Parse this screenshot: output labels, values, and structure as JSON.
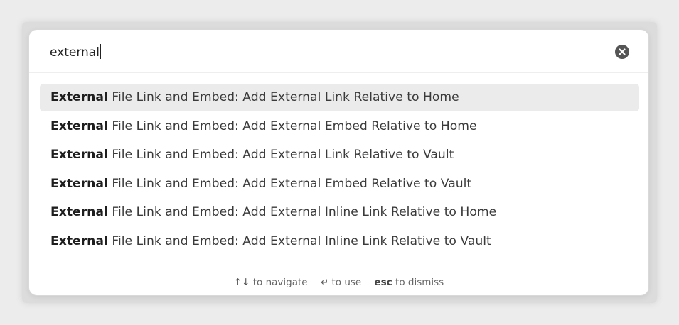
{
  "search": {
    "value": "external",
    "clear_icon": "close-circle-icon"
  },
  "results": [
    {
      "match": "External",
      "rest": " File Link and Embed: Add External Link Relative to Home",
      "selected": true
    },
    {
      "match": "External",
      "rest": " File Link and Embed: Add External Embed Relative to Home",
      "selected": false
    },
    {
      "match": "External",
      "rest": " File Link and Embed: Add External Link Relative to Vault",
      "selected": false
    },
    {
      "match": "External",
      "rest": " File Link and Embed: Add External Embed Relative to Vault",
      "selected": false
    },
    {
      "match": "External",
      "rest": " File Link and Embed: Add External Inline Link Relative to Home",
      "selected": false
    },
    {
      "match": "External",
      "rest": " File Link and Embed: Add External Inline Link Relative to Vault",
      "selected": false
    }
  ],
  "footer": {
    "navigate_key": "↑↓",
    "navigate_label": "to navigate",
    "use_key": "↵",
    "use_label": "to use",
    "dismiss_key": "esc",
    "dismiss_label": "to dismiss"
  },
  "colors": {
    "selected_row": "#ebebeb",
    "clear_button": "#555555"
  }
}
